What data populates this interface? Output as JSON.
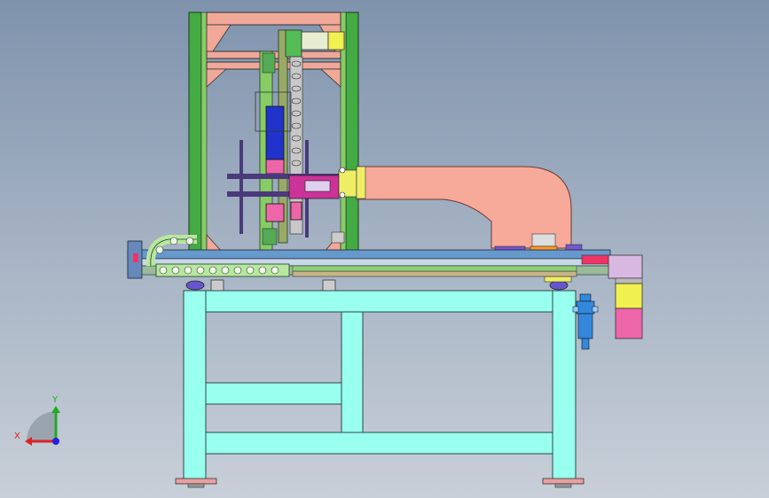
{
  "viewport": {
    "background_top": "#7f93ad",
    "background_bottom": "#c8cfd8"
  },
  "colors": {
    "table_frame": "#99ffee",
    "table_edge": "#2b4a46",
    "tower_green": "#44aa44",
    "tower_salmon": "#f0a898",
    "arm_salmon": "#f7a99a",
    "carriage_magenta": "#cc3399",
    "column_blue": "#2233cc",
    "purple": "#4a3a7a",
    "chain_green": "#b8e8a0",
    "motor_yellow": "#f0f050",
    "motor_pink": "#ee66aa",
    "filter_blue": "#3388dd"
  },
  "model": {
    "name": "gantry-arm-machine",
    "parts": [
      "base-table-frame",
      "vertical-tower",
      "horizontal-rail",
      "cable-chain",
      "swing-arm",
      "servo-motor",
      "air-filter-regulator"
    ]
  },
  "triad": {
    "x_label": "X",
    "y_label": "Y",
    "x_color": "#dd2222",
    "y_color": "#22aa22",
    "z_color": "#2222dd"
  }
}
